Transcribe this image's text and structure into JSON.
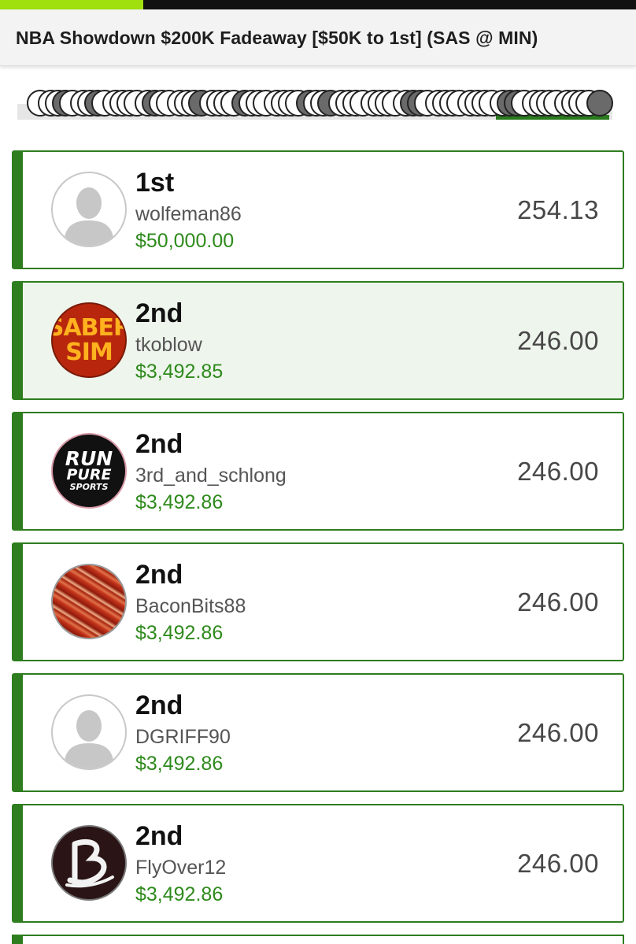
{
  "contest": {
    "title": "NBA Showdown $200K Fadeaway [$50K to 1st] (SAS @ MIN)"
  },
  "leaderboard": [
    {
      "rank": "1st",
      "user": "wolfeman86",
      "prize": "$50,000.00",
      "score": "254.13",
      "avatar": "default-avatar-icon",
      "highlighted": false
    },
    {
      "rank": "2nd",
      "user": "tkoblow",
      "prize": "$3,492.85",
      "score": "246.00",
      "avatar": "sabersim-logo",
      "avatar_text": [
        "SABER",
        "SIM"
      ],
      "highlighted": true
    },
    {
      "rank": "2nd",
      "user": "3rd_and_schlong",
      "prize": "$3,492.86",
      "score": "246.00",
      "avatar": "runpure-logo",
      "avatar_text": [
        "RUN",
        "PURE",
        "SPORTS"
      ],
      "highlighted": false
    },
    {
      "rank": "2nd",
      "user": "BaconBits88",
      "prize": "$3,492.86",
      "score": "246.00",
      "avatar": "bacon-photo",
      "highlighted": false
    },
    {
      "rank": "2nd",
      "user": "DGRIFF90",
      "prize": "$3,492.86",
      "score": "246.00",
      "avatar": "default-avatar-icon",
      "highlighted": false
    },
    {
      "rank": "2nd",
      "user": "FlyOver12",
      "prize": "$3,492.86",
      "score": "246.00",
      "avatar": "b-logo",
      "highlighted": false
    }
  ],
  "colors": {
    "accent_green": "#2e7d1f",
    "prize_green": "#2e8a1c",
    "progress_lime": "#9fe00e",
    "highlight_bg": "#eef5ec"
  }
}
